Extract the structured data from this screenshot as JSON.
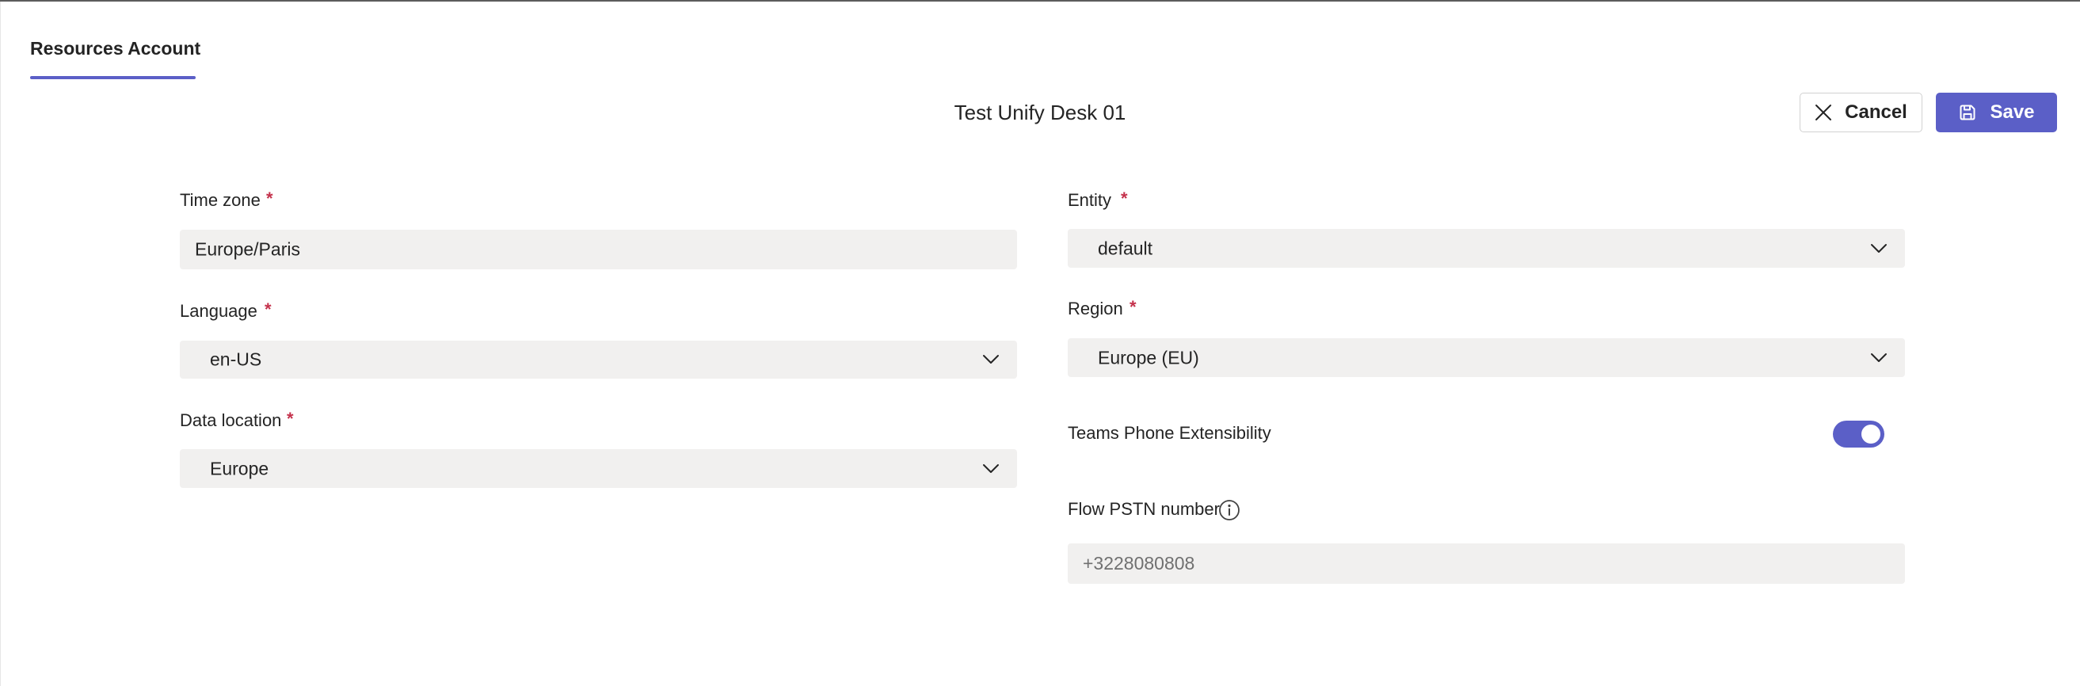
{
  "tab": {
    "label": "Resources Account"
  },
  "page": {
    "title": "Test Unify Desk 01"
  },
  "actions": {
    "cancel_label": "Cancel",
    "save_label": "Save",
    "cancel_icon": "close-icon",
    "save_icon": "save-icon"
  },
  "form": {
    "time_zone": {
      "label": "Time zone",
      "required_mark": "*",
      "value": "Europe/Paris"
    },
    "language": {
      "label": "Language",
      "required_mark": "*",
      "value": "en-US"
    },
    "data_location": {
      "label": "Data location",
      "required_mark": "*",
      "value": "Europe"
    },
    "entity": {
      "label": "Entity",
      "required_mark": "*",
      "value": "default"
    },
    "region": {
      "label": "Region",
      "required_mark": "*",
      "value": "Europe (EU)"
    },
    "teams_phone": {
      "label": "Teams Phone Extensibility",
      "enabled": true
    },
    "flow_pstn": {
      "label": "Flow PSTN number",
      "value": "",
      "placeholder": "+3228080808",
      "info_icon": "info-icon"
    }
  },
  "colors": {
    "accent": "#5b5fc7",
    "required": "#c4314b",
    "field_background": "#f1f0ef"
  }
}
